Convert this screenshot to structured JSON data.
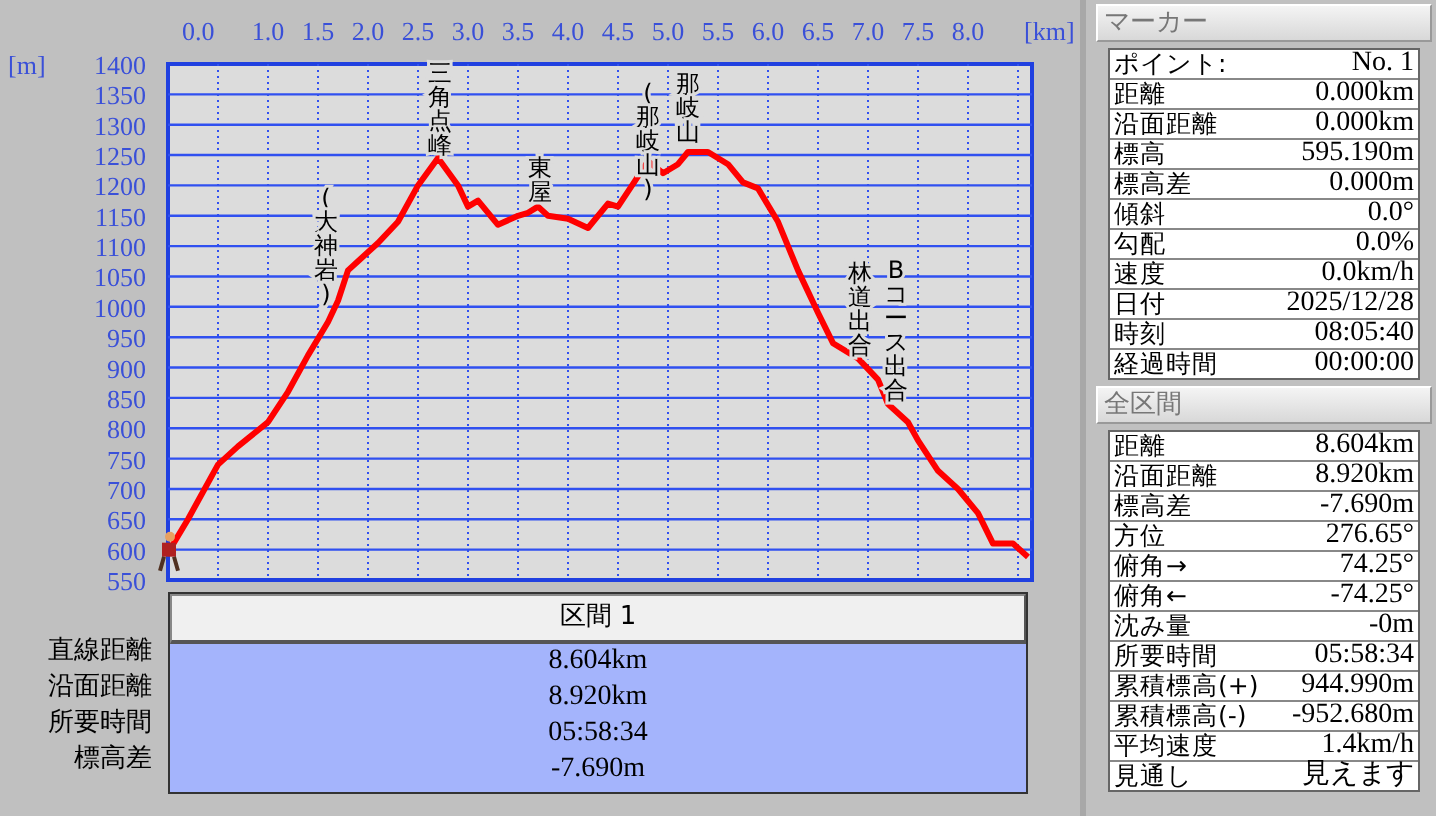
{
  "profile": {
    "chart_data": {
      "type": "line",
      "xlabel": "[km]",
      "ylabel": "[m]",
      "xlim": [
        0,
        8.64
      ],
      "ylim": [
        550,
        1400
      ],
      "xticks": [
        {
          "value": 0,
          "label": "0.0"
        },
        {
          "value": 1,
          "label": "1.0"
        },
        {
          "value": 1.5,
          "label": "1.5"
        },
        {
          "value": 2,
          "label": "2.0"
        },
        {
          "value": 2.5,
          "label": "2.5"
        },
        {
          "value": 3,
          "label": "3.0"
        },
        {
          "value": 3.5,
          "label": "3.5"
        },
        {
          "value": 4,
          "label": "4.0"
        },
        {
          "value": 4.5,
          "label": "4.5"
        },
        {
          "value": 5,
          "label": "5.0"
        },
        {
          "value": 5.5,
          "label": "5.5"
        },
        {
          "value": 6,
          "label": "6.0"
        },
        {
          "value": 6.5,
          "label": "6.5"
        },
        {
          "value": 7,
          "label": "7.0"
        },
        {
          "value": 7.5,
          "label": "7.5"
        },
        {
          "value": 8,
          "label": "8.0"
        }
      ],
      "yticks": [
        1400,
        1350,
        1300,
        1250,
        1200,
        1150,
        1100,
        1050,
        1000,
        950,
        900,
        850,
        800,
        750,
        700,
        650,
        600,
        550
      ],
      "x": [
        0,
        0.2,
        0.3,
        0.5,
        0.7,
        1.0,
        1.2,
        1.4,
        1.6,
        1.7,
        1.8,
        1.9,
        2.1,
        2.3,
        2.5,
        2.7,
        2.9,
        3.0,
        3.1,
        3.3,
        3.5,
        3.6,
        3.7,
        3.8,
        4.0,
        4.2,
        4.4,
        4.5,
        4.7,
        4.8,
        4.95,
        5.1,
        5.2,
        5.4,
        5.6,
        5.75,
        5.9,
        6.1,
        6.3,
        6.5,
        6.65,
        6.9,
        7.1,
        7.2,
        7.4,
        7.5,
        7.7,
        7.9,
        8.1,
        8.25,
        8.45,
        8.6
      ],
      "grid": true,
      "series": [
        {
          "color": "#ff0000",
          "values": [
            595,
            650,
            680,
            740,
            770,
            810,
            860,
            920,
            975,
            1010,
            1060,
            1075,
            1105,
            1140,
            1200,
            1245,
            1200,
            1165,
            1175,
            1135,
            1150,
            1155,
            1165,
            1150,
            1145,
            1130,
            1170,
            1165,
            1215,
            1240,
            1220,
            1235,
            1255,
            1255,
            1235,
            1205,
            1195,
            1140,
            1060,
            990,
            940,
            915,
            880,
            840,
            810,
            780,
            730,
            700,
            660,
            610,
            610,
            588
          ]
        }
      ],
      "annotations": [
        "(大神岩)",
        "三角点峰",
        "東屋",
        "(那岐山)",
        "那岐山",
        "林道出合",
        "Bコース出合"
      ]
    }
  },
  "section_table": {
    "header": "区間 1",
    "rows": [
      {
        "label": "直線距離",
        "value": "8.604km"
      },
      {
        "label": "沿面距離",
        "value": "8.920km"
      },
      {
        "label": "所要時間",
        "value": "05:58:34"
      },
      {
        "label": "標高差",
        "value": "-7.690m"
      }
    ]
  },
  "marker_panel": {
    "title": "マーカー",
    "rows": [
      {
        "label": "ポイント:",
        "value": "No. 1"
      },
      {
        "label": "距離",
        "value": "0.000km"
      },
      {
        "label": "沿面距離",
        "value": "0.000km"
      },
      {
        "label": "標高",
        "value": "595.190m"
      },
      {
        "label": "標高差",
        "value": "0.000m"
      },
      {
        "label": "傾斜",
        "value": "0.0°"
      },
      {
        "label": "勾配",
        "value": "0.0%"
      },
      {
        "label": "速度",
        "value": "0.0km/h"
      },
      {
        "label": "日付",
        "value": "2025/12/28"
      },
      {
        "label": "時刻",
        "value": "08:05:40"
      },
      {
        "label": "経過時間",
        "value": "00:00:00"
      }
    ]
  },
  "total_panel": {
    "title": "全区間",
    "rows": [
      {
        "label": "距離",
        "value": "8.604km"
      },
      {
        "label": "沿面距離",
        "value": "8.920km"
      },
      {
        "label": "標高差",
        "value": "-7.690m"
      },
      {
        "label": "方位",
        "value": "276.65°"
      },
      {
        "label": "俯角→",
        "value": "74.25°"
      },
      {
        "label": "俯角←",
        "value": "-74.25°"
      },
      {
        "label": "沈み量",
        "value": "-0m"
      },
      {
        "label": "所要時間",
        "value": "05:58:34"
      },
      {
        "label": "累積標高(+)",
        "value": "944.990m"
      },
      {
        "label": "累積標高(-)",
        "value": "-952.680m"
      },
      {
        "label": "平均速度",
        "value": "1.4km/h"
      },
      {
        "label": "見通し",
        "value": "見えます"
      }
    ]
  }
}
